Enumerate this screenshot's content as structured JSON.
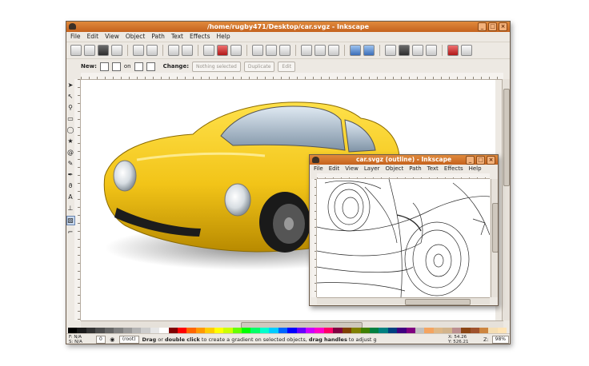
{
  "main_window": {
    "title": "/home/rugby471/Desktop/car.svgz - Inkscape",
    "menu": [
      "File",
      "Edit",
      "View",
      "Object",
      "Path",
      "Text",
      "Effects",
      "Help"
    ],
    "toolbar2": {
      "new_label": "New:",
      "on_label": "on",
      "change_label": "Change:",
      "nothing_selected": "Nothing selected",
      "duplicate": "Duplicate",
      "edit": "Edit"
    },
    "status": {
      "fill_label": "F:",
      "fill_value": "N/A",
      "stroke_label": "S:",
      "stroke_value": "N/A",
      "opacity": "0",
      "layer": "(root)",
      "message_bold1": "Drag",
      "message_part1": " or ",
      "message_bold2": "double click",
      "message_part2": " to create a gradient on selected objects, ",
      "message_bold3": "drag handles",
      "message_part3": " to adjust g",
      "x_label": "X:",
      "x_value": "54.26",
      "y_label": "Y:",
      "y_value": "526.21",
      "zoom_label": "Z:",
      "zoom_value": "98%"
    },
    "palette": [
      "#000000",
      "#1a1a1a",
      "#333333",
      "#4d4d4d",
      "#666666",
      "#808080",
      "#999999",
      "#b3b3b3",
      "#cccccc",
      "#e6e6e6",
      "#ffffff",
      "#800000",
      "#ff0000",
      "#ff6600",
      "#ff9900",
      "#ffcc00",
      "#ffff00",
      "#ccff00",
      "#66ff00",
      "#00ff00",
      "#00ff66",
      "#00ffcc",
      "#00ccff",
      "#0066ff",
      "#0000ff",
      "#6600ff",
      "#cc00ff",
      "#ff00cc",
      "#ff0066",
      "#800040",
      "#804000",
      "#808000",
      "#408000",
      "#008040",
      "#008080",
      "#004080",
      "#400080",
      "#800080",
      "#c0c0c0",
      "#f4a460",
      "#deb887",
      "#d2b48c",
      "#bc8f8f",
      "#8b4513",
      "#a0522d",
      "#cd853f",
      "#f5deb3",
      "#ffe4b5"
    ]
  },
  "outline_window": {
    "title": "car.svgz (outline) - Inkscape",
    "menu": [
      "File",
      "Edit",
      "View",
      "Layer",
      "Object",
      "Path",
      "Text",
      "Effects",
      "Help"
    ]
  }
}
